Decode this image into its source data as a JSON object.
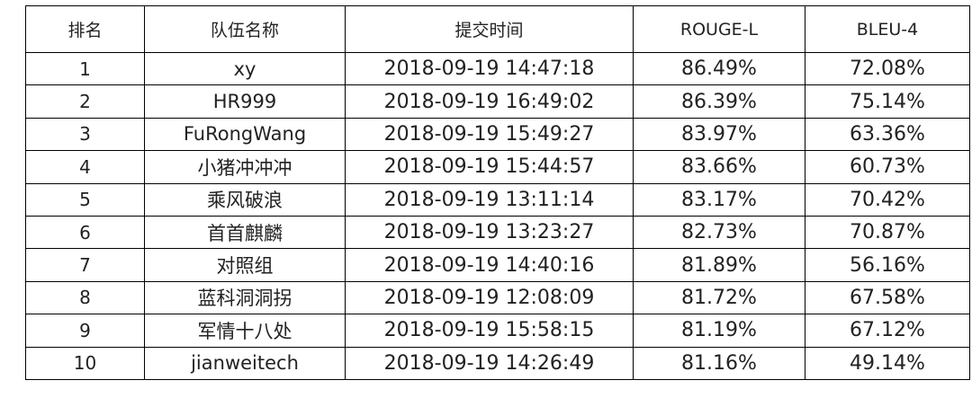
{
  "table": {
    "headers": [
      "排名",
      "队伍名称",
      "提交时间",
      "ROUGE-L",
      "BLEU-4"
    ],
    "rows": [
      [
        "1",
        "xy",
        "2018-09-19 14:47:18",
        "86.49%",
        "72.08%"
      ],
      [
        "2",
        "HR999",
        "2018-09-19 16:49:02",
        "86.39%",
        "75.14%"
      ],
      [
        "3",
        "FuRongWang",
        "2018-09-19 15:49:27",
        "83.97%",
        "63.36%"
      ],
      [
        "4",
        "小猪冲冲冲",
        "2018-09-19 15:44:57",
        "83.66%",
        "60.73%"
      ],
      [
        "5",
        "乘风破浪",
        "2018-09-19 13:11:14",
        "83.17%",
        "70.42%"
      ],
      [
        "6",
        "首首麒麟",
        "2018-09-19 13:23:27",
        "82.73%",
        "70.87%"
      ],
      [
        "7",
        "对照组",
        "2018-09-19 14:40:16",
        "81.89%",
        "56.16%"
      ],
      [
        "8",
        "蓝科洞洞拐",
        "2018-09-19 12:08:09",
        "81.72%",
        "67.58%"
      ],
      [
        "9",
        "军情十八处",
        "2018-09-19 15:58:15",
        "81.19%",
        "67.12%"
      ],
      [
        "10",
        "jianweitech",
        "2018-09-19 14:26:49",
        "81.16%",
        "49.14%"
      ]
    ]
  }
}
